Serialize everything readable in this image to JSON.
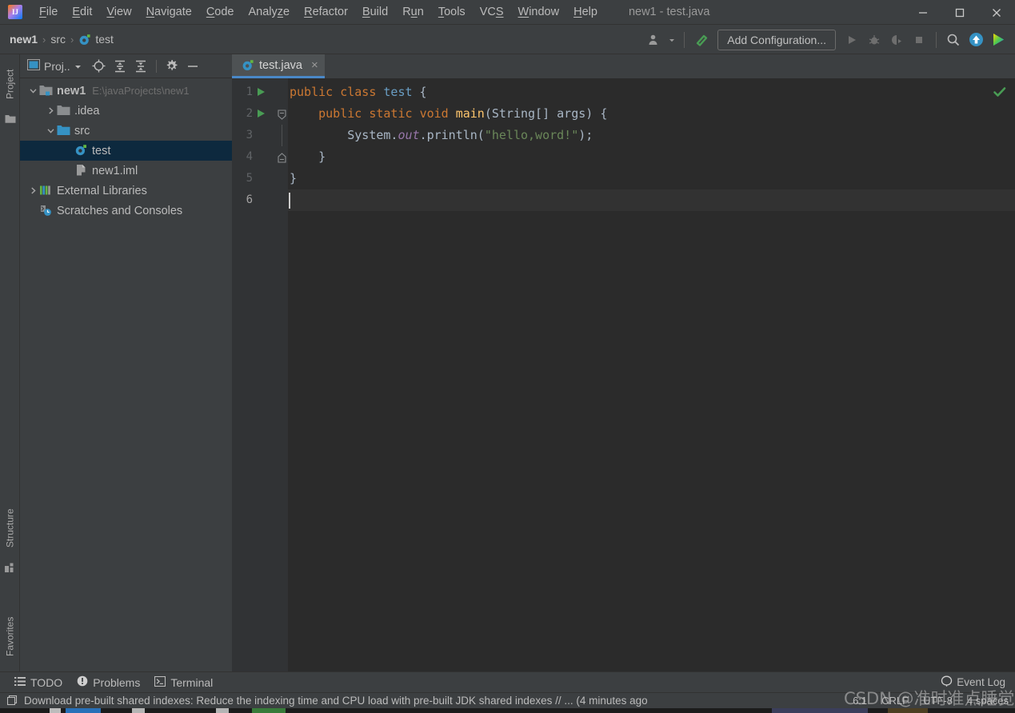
{
  "window": {
    "title": "new1 - test.java",
    "logo_text": "IJ",
    "controls": {
      "minimize": "minimize-icon",
      "maximize": "maximize-icon",
      "close": "close-icon"
    }
  },
  "menubar": {
    "items": [
      {
        "label": "File",
        "mnemonic": "F"
      },
      {
        "label": "Edit",
        "mnemonic": "E"
      },
      {
        "label": "View",
        "mnemonic": "V"
      },
      {
        "label": "Navigate",
        "mnemonic": "N"
      },
      {
        "label": "Code",
        "mnemonic": "C"
      },
      {
        "label": "Analyze",
        "mnemonic": "z"
      },
      {
        "label": "Refactor",
        "mnemonic": "R"
      },
      {
        "label": "Build",
        "mnemonic": "B"
      },
      {
        "label": "Run",
        "mnemonic": "u"
      },
      {
        "label": "Tools",
        "mnemonic": "T"
      },
      {
        "label": "VCS",
        "mnemonic": "S"
      },
      {
        "label": "Window",
        "mnemonic": "W"
      },
      {
        "label": "Help",
        "mnemonic": "H"
      }
    ]
  },
  "navbar": {
    "breadcrumbs": [
      {
        "label": "new1",
        "bold": true,
        "icon": null
      },
      {
        "label": "src",
        "bold": false,
        "icon": null
      },
      {
        "label": "test",
        "bold": false,
        "icon": "java-class-icon"
      }
    ],
    "separator": "›",
    "run_config_label": "Add Configuration...",
    "buttons": [
      "user-avatar-icon",
      "chevron-down-icon",
      "hammer-build-icon",
      "run-icon",
      "debug-icon",
      "run-coverage-icon",
      "stop-icon",
      "search-everywhere-icon",
      "updates-icon",
      "ide-features-icon"
    ]
  },
  "left_strip": {
    "top_tab": {
      "label": "Project",
      "icon": "project-folder-icon"
    },
    "bottom_tabs": [
      {
        "label": "Structure",
        "icon": "structure-icon"
      },
      {
        "label": "Favorites",
        "icon": "star-icon"
      }
    ]
  },
  "project_panel": {
    "title": "Proj..",
    "toolbar_icons": [
      "project-view-icon",
      "chevron-down-icon",
      "locate-target-icon",
      "expand-all-icon",
      "collapse-all-icon",
      "gear-icon",
      "hide-icon"
    ],
    "tree": [
      {
        "label": "new1",
        "path": "E:\\javaProjects\\new1",
        "icon": "module-folder-icon",
        "arrow": "expanded",
        "indent": 0,
        "selected": false,
        "bold": true
      },
      {
        "label": ".idea",
        "path": "",
        "icon": "folder-icon",
        "arrow": "collapsed",
        "indent": 1,
        "selected": false,
        "bold": false
      },
      {
        "label": "src",
        "path": "",
        "icon": "source-folder-icon",
        "arrow": "expanded",
        "indent": 1,
        "selected": false,
        "bold": false
      },
      {
        "label": "test",
        "path": "",
        "icon": "java-class-icon",
        "arrow": "none",
        "indent": 2,
        "selected": true,
        "bold": false
      },
      {
        "label": "new1.iml",
        "path": "",
        "icon": "iml-file-icon",
        "arrow": "none",
        "indent": 2,
        "selected": false,
        "bold": false
      },
      {
        "label": "External Libraries",
        "path": "",
        "icon": "libraries-icon",
        "arrow": "collapsed",
        "indent": 0,
        "selected": false,
        "bold": false
      },
      {
        "label": "Scratches and Consoles",
        "path": "",
        "icon": "scratches-icon",
        "arrow": "none",
        "indent": 0,
        "selected": false,
        "bold": false
      }
    ]
  },
  "editor": {
    "tabs": [
      {
        "label": "test.java",
        "icon": "java-class-icon",
        "close": "×",
        "active": true
      }
    ],
    "inspection_status": "ok-check-icon",
    "lines": [
      {
        "n": "1",
        "run_marker": true,
        "fold": "none",
        "indent": 0
      },
      {
        "n": "2",
        "run_marker": true,
        "fold": "open",
        "indent": 1
      },
      {
        "n": "3",
        "run_marker": false,
        "fold": "body",
        "indent": 2
      },
      {
        "n": "4",
        "run_marker": false,
        "fold": "close",
        "indent": 1
      },
      {
        "n": "5",
        "run_marker": false,
        "fold": "none",
        "indent": 0
      },
      {
        "n": "6",
        "run_marker": false,
        "fold": "none",
        "indent": 0
      }
    ],
    "code_tokens": [
      [
        {
          "t": "public",
          "c": "kw"
        },
        {
          "t": " ",
          "c": "plain"
        },
        {
          "t": "class",
          "c": "kw"
        },
        {
          "t": " ",
          "c": "plain"
        },
        {
          "t": "test",
          "c": "type-blue"
        },
        {
          "t": " {",
          "c": "plain"
        }
      ],
      [
        {
          "t": "    ",
          "c": "plain"
        },
        {
          "t": "public",
          "c": "kw"
        },
        {
          "t": " ",
          "c": "plain"
        },
        {
          "t": "static",
          "c": "kw"
        },
        {
          "t": " ",
          "c": "plain"
        },
        {
          "t": "void",
          "c": "kw"
        },
        {
          "t": " ",
          "c": "plain"
        },
        {
          "t": "main",
          "c": "fn"
        },
        {
          "t": "(String[] args) {",
          "c": "plain"
        }
      ],
      [
        {
          "t": "        System.",
          "c": "plain"
        },
        {
          "t": "out",
          "c": "fld"
        },
        {
          "t": ".println(",
          "c": "plain"
        },
        {
          "t": "\"hello,word!\"",
          "c": "str"
        },
        {
          "t": ");",
          "c": "plain"
        }
      ],
      [
        {
          "t": "    }",
          "c": "plain"
        }
      ],
      [
        {
          "t": "}",
          "c": "plain"
        }
      ],
      [
        {
          "t": "",
          "c": "plain"
        }
      ]
    ],
    "caret_line_index": 5
  },
  "bottom_bar": {
    "items": [
      {
        "label": "TODO",
        "icon": "todo-list-icon"
      },
      {
        "label": "Problems",
        "icon": "problems-icon"
      },
      {
        "label": "Terminal",
        "icon": "terminal-icon"
      }
    ],
    "event_log": {
      "label": "Event Log",
      "icon": "event-log-icon"
    }
  },
  "status_bar": {
    "icon": "notification-icon",
    "message": "Download pre-built shared indexes: Reduce the indexing time and CPU load with pre-built JDK shared indexes // ... (4 minutes ago",
    "caret_position": "6:1",
    "line_separator": "CRLF",
    "encoding": "UTF-8",
    "indent": "4 spaces"
  },
  "watermark": {
    "text": "CSDN @准时准点睡觉"
  },
  "colors": {
    "chrome_bg": "#3c3f41",
    "editor_bg": "#2b2b2b",
    "gutter_bg": "#313335",
    "selection_bg": "#0d293e",
    "tab_active_bg": "#4e5254",
    "tab_underline": "#4a88c7",
    "keyword": "#cc7832",
    "string": "#6a8759",
    "method": "#ffc66d",
    "field": "#9876aa",
    "default_text": "#a9b7c6",
    "run_green": "#499c54",
    "accent_blue": "#3592c4"
  }
}
